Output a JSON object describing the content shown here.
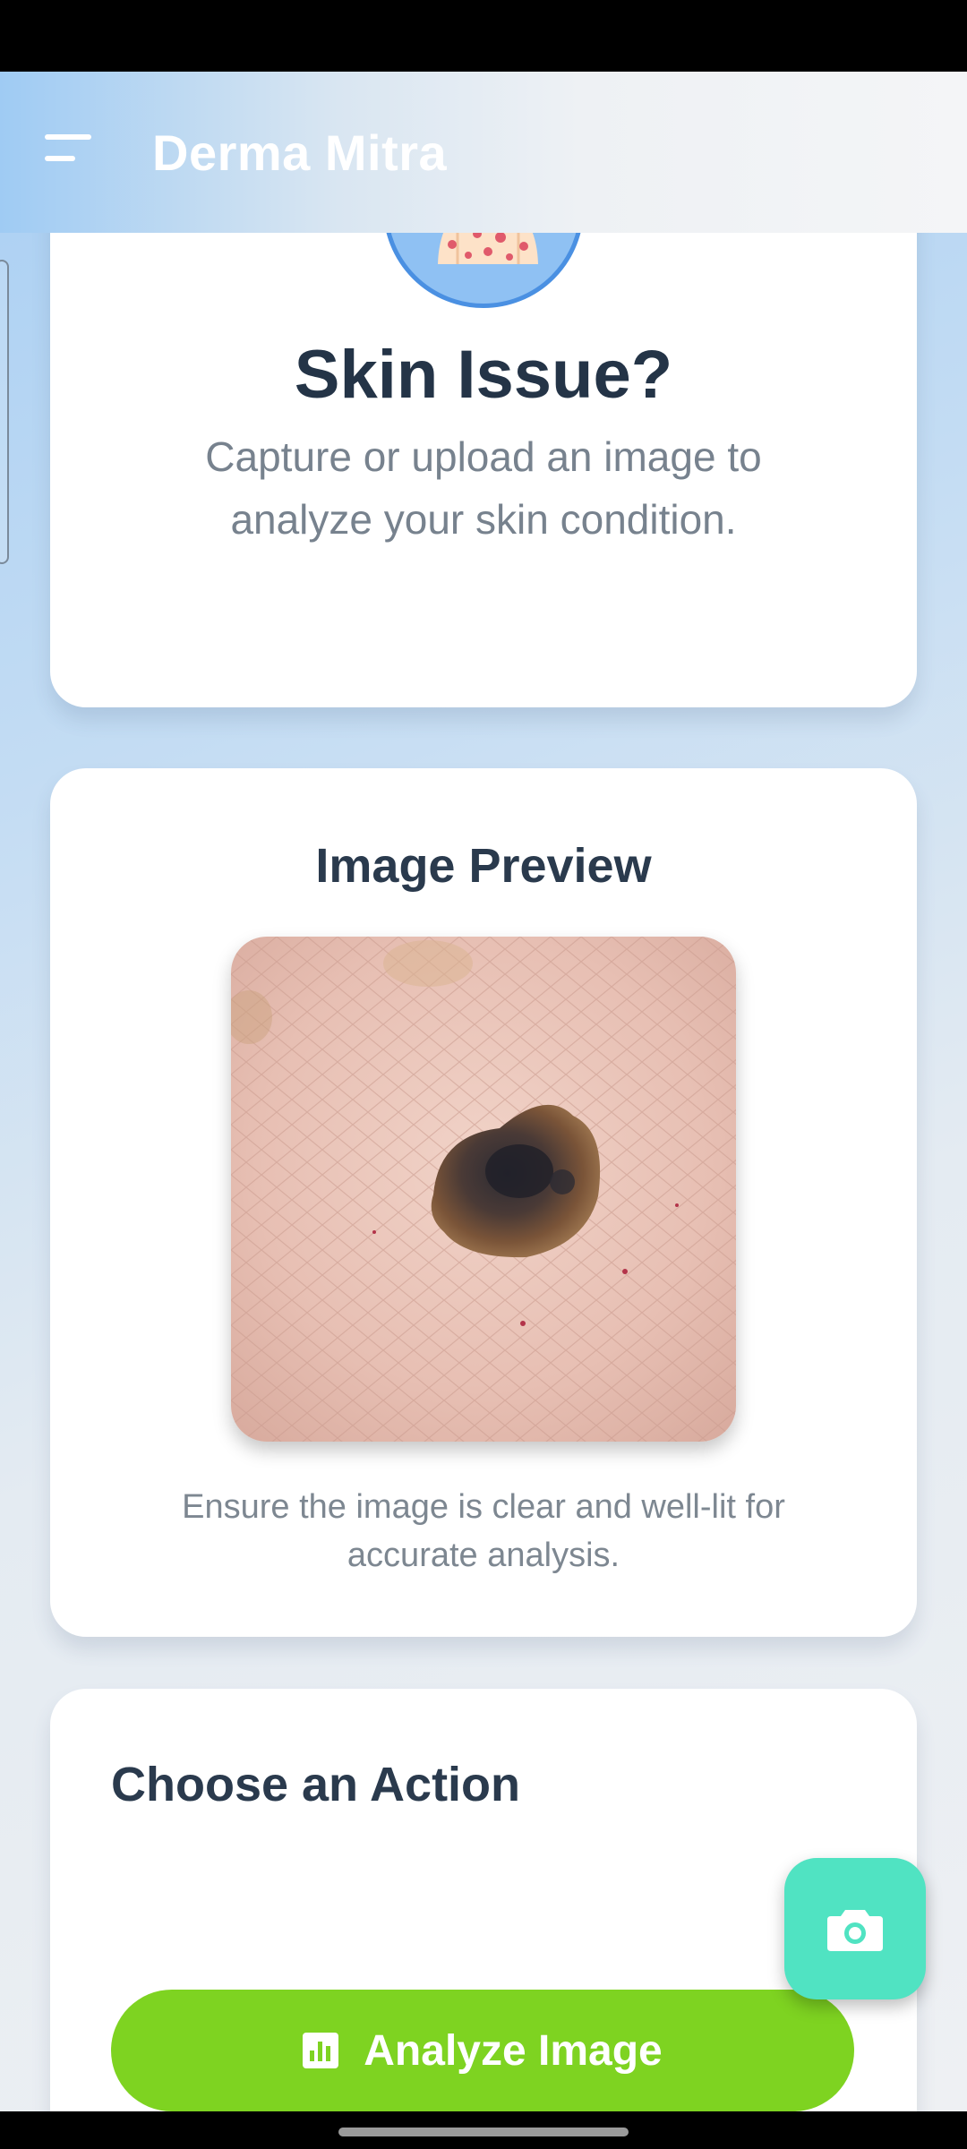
{
  "app": {
    "title": "Derma Mitra"
  },
  "hero": {
    "title": "Skin Issue?",
    "subtitle": "Capture or upload an image to analyze your skin condition."
  },
  "preview": {
    "title": "Image Preview",
    "note": "Ensure the image is clear and well-lit for accurate analysis."
  },
  "actions": {
    "title": "Choose an Action",
    "analyze_label": "Analyze Image"
  },
  "icons": {
    "menu": "menu-icon",
    "hero": "skin-rash-person-icon",
    "analyze": "bar-chart-icon",
    "fab": "camera-icon"
  },
  "colors": {
    "primary_text": "#243447",
    "secondary_text": "#77828e",
    "analyze_button": "#7ed321",
    "fab": "#50e3c2",
    "avatar_bg": "#8fc1f3",
    "avatar_border": "#4a90e2"
  }
}
